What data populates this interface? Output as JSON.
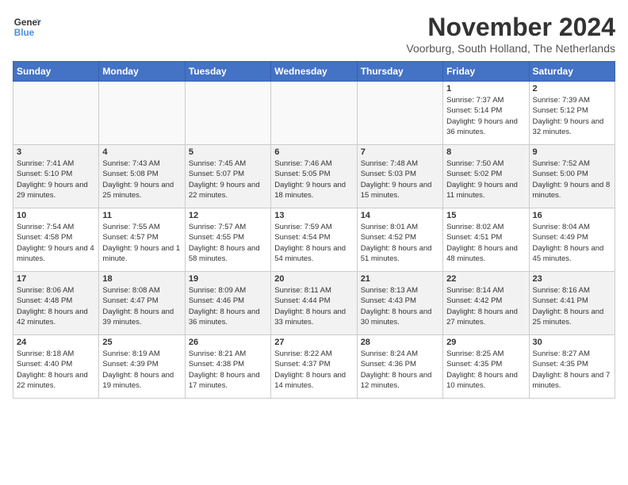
{
  "logo": {
    "line1": "General",
    "line2": "Blue"
  },
  "title": "November 2024",
  "location": "Voorburg, South Holland, The Netherlands",
  "days_of_week": [
    "Sunday",
    "Monday",
    "Tuesday",
    "Wednesday",
    "Thursday",
    "Friday",
    "Saturday"
  ],
  "weeks": [
    [
      {
        "day": "",
        "info": ""
      },
      {
        "day": "",
        "info": ""
      },
      {
        "day": "",
        "info": ""
      },
      {
        "day": "",
        "info": ""
      },
      {
        "day": "",
        "info": ""
      },
      {
        "day": "1",
        "info": "Sunrise: 7:37 AM\nSunset: 5:14 PM\nDaylight: 9 hours and 36 minutes."
      },
      {
        "day": "2",
        "info": "Sunrise: 7:39 AM\nSunset: 5:12 PM\nDaylight: 9 hours and 32 minutes."
      }
    ],
    [
      {
        "day": "3",
        "info": "Sunrise: 7:41 AM\nSunset: 5:10 PM\nDaylight: 9 hours and 29 minutes."
      },
      {
        "day": "4",
        "info": "Sunrise: 7:43 AM\nSunset: 5:08 PM\nDaylight: 9 hours and 25 minutes."
      },
      {
        "day": "5",
        "info": "Sunrise: 7:45 AM\nSunset: 5:07 PM\nDaylight: 9 hours and 22 minutes."
      },
      {
        "day": "6",
        "info": "Sunrise: 7:46 AM\nSunset: 5:05 PM\nDaylight: 9 hours and 18 minutes."
      },
      {
        "day": "7",
        "info": "Sunrise: 7:48 AM\nSunset: 5:03 PM\nDaylight: 9 hours and 15 minutes."
      },
      {
        "day": "8",
        "info": "Sunrise: 7:50 AM\nSunset: 5:02 PM\nDaylight: 9 hours and 11 minutes."
      },
      {
        "day": "9",
        "info": "Sunrise: 7:52 AM\nSunset: 5:00 PM\nDaylight: 9 hours and 8 minutes."
      }
    ],
    [
      {
        "day": "10",
        "info": "Sunrise: 7:54 AM\nSunset: 4:58 PM\nDaylight: 9 hours and 4 minutes."
      },
      {
        "day": "11",
        "info": "Sunrise: 7:55 AM\nSunset: 4:57 PM\nDaylight: 9 hours and 1 minute."
      },
      {
        "day": "12",
        "info": "Sunrise: 7:57 AM\nSunset: 4:55 PM\nDaylight: 8 hours and 58 minutes."
      },
      {
        "day": "13",
        "info": "Sunrise: 7:59 AM\nSunset: 4:54 PM\nDaylight: 8 hours and 54 minutes."
      },
      {
        "day": "14",
        "info": "Sunrise: 8:01 AM\nSunset: 4:52 PM\nDaylight: 8 hours and 51 minutes."
      },
      {
        "day": "15",
        "info": "Sunrise: 8:02 AM\nSunset: 4:51 PM\nDaylight: 8 hours and 48 minutes."
      },
      {
        "day": "16",
        "info": "Sunrise: 8:04 AM\nSunset: 4:49 PM\nDaylight: 8 hours and 45 minutes."
      }
    ],
    [
      {
        "day": "17",
        "info": "Sunrise: 8:06 AM\nSunset: 4:48 PM\nDaylight: 8 hours and 42 minutes."
      },
      {
        "day": "18",
        "info": "Sunrise: 8:08 AM\nSunset: 4:47 PM\nDaylight: 8 hours and 39 minutes."
      },
      {
        "day": "19",
        "info": "Sunrise: 8:09 AM\nSunset: 4:46 PM\nDaylight: 8 hours and 36 minutes."
      },
      {
        "day": "20",
        "info": "Sunrise: 8:11 AM\nSunset: 4:44 PM\nDaylight: 8 hours and 33 minutes."
      },
      {
        "day": "21",
        "info": "Sunrise: 8:13 AM\nSunset: 4:43 PM\nDaylight: 8 hours and 30 minutes."
      },
      {
        "day": "22",
        "info": "Sunrise: 8:14 AM\nSunset: 4:42 PM\nDaylight: 8 hours and 27 minutes."
      },
      {
        "day": "23",
        "info": "Sunrise: 8:16 AM\nSunset: 4:41 PM\nDaylight: 8 hours and 25 minutes."
      }
    ],
    [
      {
        "day": "24",
        "info": "Sunrise: 8:18 AM\nSunset: 4:40 PM\nDaylight: 8 hours and 22 minutes."
      },
      {
        "day": "25",
        "info": "Sunrise: 8:19 AM\nSunset: 4:39 PM\nDaylight: 8 hours and 19 minutes."
      },
      {
        "day": "26",
        "info": "Sunrise: 8:21 AM\nSunset: 4:38 PM\nDaylight: 8 hours and 17 minutes."
      },
      {
        "day": "27",
        "info": "Sunrise: 8:22 AM\nSunset: 4:37 PM\nDaylight: 8 hours and 14 minutes."
      },
      {
        "day": "28",
        "info": "Sunrise: 8:24 AM\nSunset: 4:36 PM\nDaylight: 8 hours and 12 minutes."
      },
      {
        "day": "29",
        "info": "Sunrise: 8:25 AM\nSunset: 4:35 PM\nDaylight: 8 hours and 10 minutes."
      },
      {
        "day": "30",
        "info": "Sunrise: 8:27 AM\nSunset: 4:35 PM\nDaylight: 8 hours and 7 minutes."
      }
    ]
  ]
}
